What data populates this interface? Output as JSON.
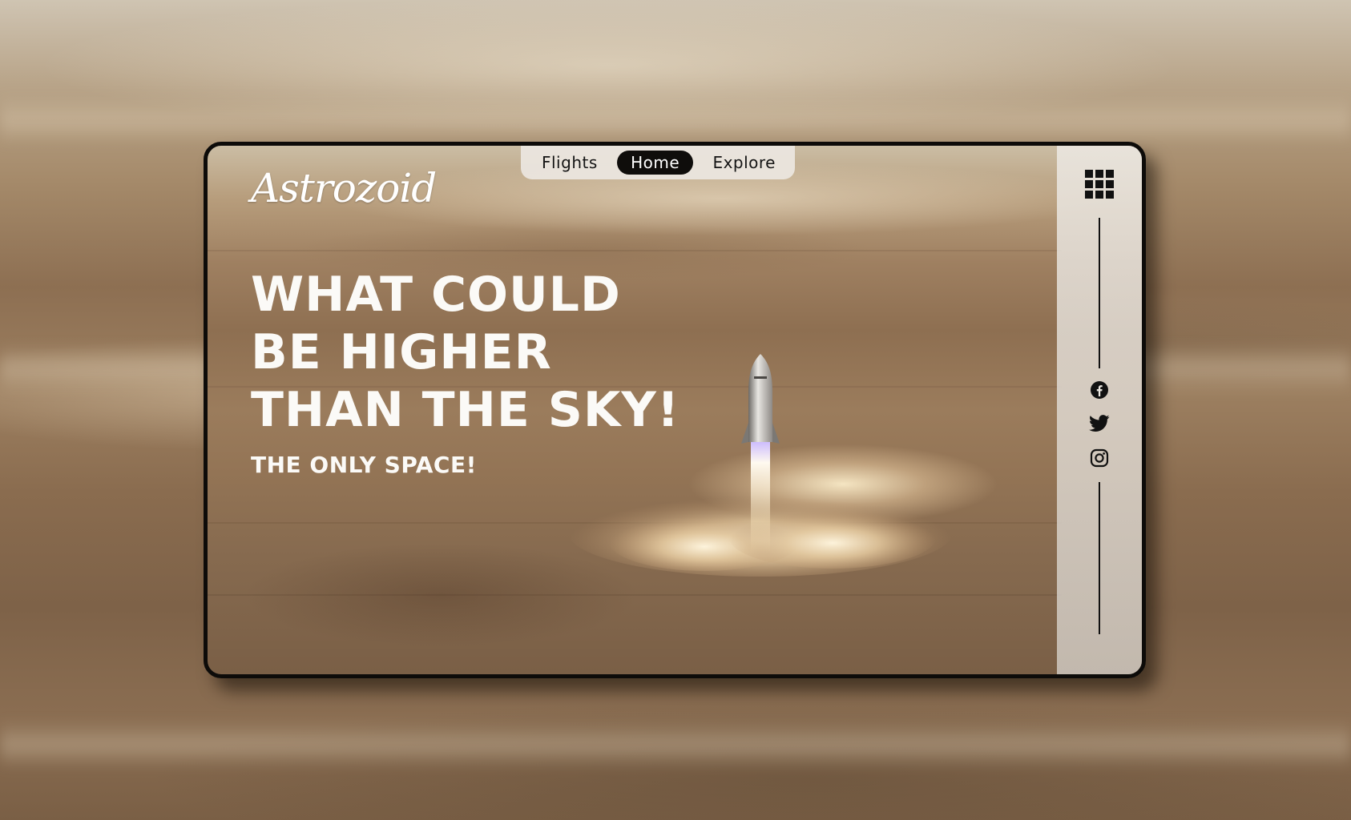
{
  "brand": {
    "logo_text": "Astrozoid"
  },
  "nav": {
    "items": [
      {
        "label": "Flights",
        "active": false
      },
      {
        "label": "Home",
        "active": true
      },
      {
        "label": "Explore",
        "active": false
      }
    ]
  },
  "hero": {
    "headline_lines": [
      "WHAT COULD",
      "BE HIGHER",
      "THAN THE SKY!"
    ],
    "subheadline": "THE ONLY SPACE!"
  },
  "sidebar": {
    "menu_icon": "grid-menu-icon",
    "social": [
      "facebook-icon",
      "twitter-icon",
      "instagram-icon"
    ]
  },
  "colors": {
    "frame_border": "#0d0b09",
    "nav_active_bg": "#0f0d0b",
    "rail_bg": "#ece8e2",
    "headline": "#fbfaf7"
  }
}
